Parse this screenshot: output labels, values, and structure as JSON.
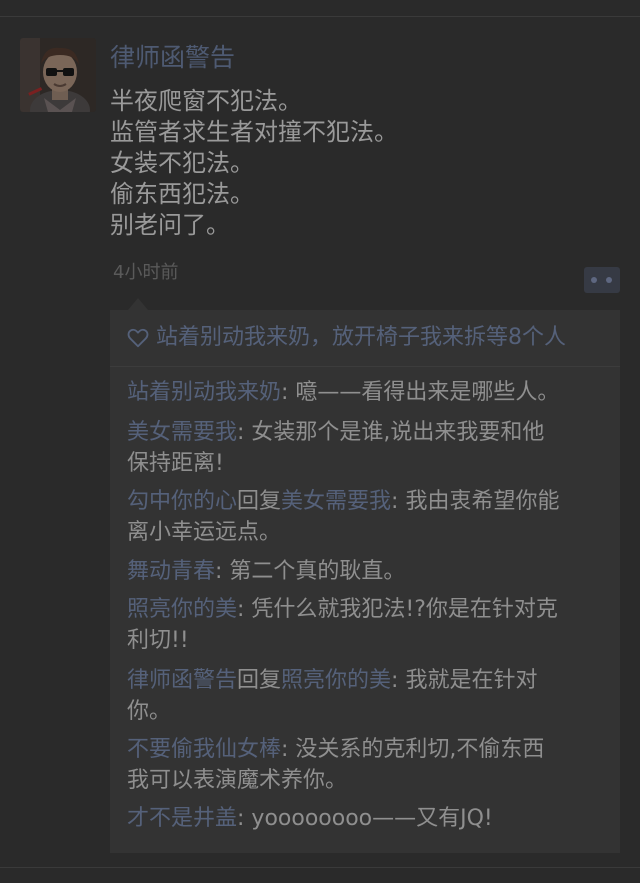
{
  "post": {
    "author": "律师函警告",
    "body_lines": [
      "半夜爬窗不犯法。",
      "监管者求生者对撞不犯法。",
      "女装不犯法。",
      "偷东西犯法。",
      "别老问了。"
    ],
    "timestamp": "4小时前",
    "avatar_icon": "avatar-portrait-icon",
    "comment_icon": "comment-dots-icon"
  },
  "likes": {
    "icon": "heart-outline-icon",
    "text": "站着别动我来奶，放开椅子我来拆等8个人"
  },
  "comments": [
    {
      "lines": [
        [
          {
            "n": "站着别动我来奶"
          },
          {
            "t": ": 噫——看得出来是哪些人。"
          }
        ]
      ]
    },
    {
      "lines": [
        [
          {
            "n": "美女需要我"
          },
          {
            "t": ": 女装那个是谁,说出来我要和他"
          }
        ],
        [
          {
            "t": "保持距离!"
          }
        ]
      ]
    },
    {
      "lines": [
        [
          {
            "n": "勾中你的心"
          },
          {
            "t": "回复"
          },
          {
            "n": "美女需要我"
          },
          {
            "t": ": 我由衷希望你能"
          }
        ],
        [
          {
            "t": "离小幸运远点。"
          }
        ]
      ]
    },
    {
      "lines": [
        [
          {
            "n": "舞动青春"
          },
          {
            "t": ": 第二个真的耿直。"
          }
        ]
      ]
    },
    {
      "lines": [
        [
          {
            "n": "照亮你的美"
          },
          {
            "t": ": 凭什么就我犯法!?你是在针对克"
          }
        ],
        [
          {
            "t": "利切!!"
          }
        ]
      ]
    },
    {
      "lines": [
        [
          {
            "n": "律师函警告"
          },
          {
            "t": "回复"
          },
          {
            "n": "照亮你的美"
          },
          {
            "t": ": 我就是在针对"
          }
        ],
        [
          {
            "t": "你。"
          }
        ]
      ]
    },
    {
      "lines": [
        [
          {
            "n": "不要偷我仙女棒"
          },
          {
            "t": ": 没关系的克利切,不偷东西"
          }
        ],
        [
          {
            "t": "我可以表演魔术养你。"
          }
        ]
      ]
    },
    {
      "lines": [
        [
          {
            "n": "才不是井盖"
          },
          {
            "t": ": yoooooooo——又有JQ!"
          }
        ]
      ]
    }
  ],
  "colors": {
    "background": "#2a2a2a",
    "panel": "#333333",
    "name": "#55617a",
    "text": "#8f8f8f"
  }
}
